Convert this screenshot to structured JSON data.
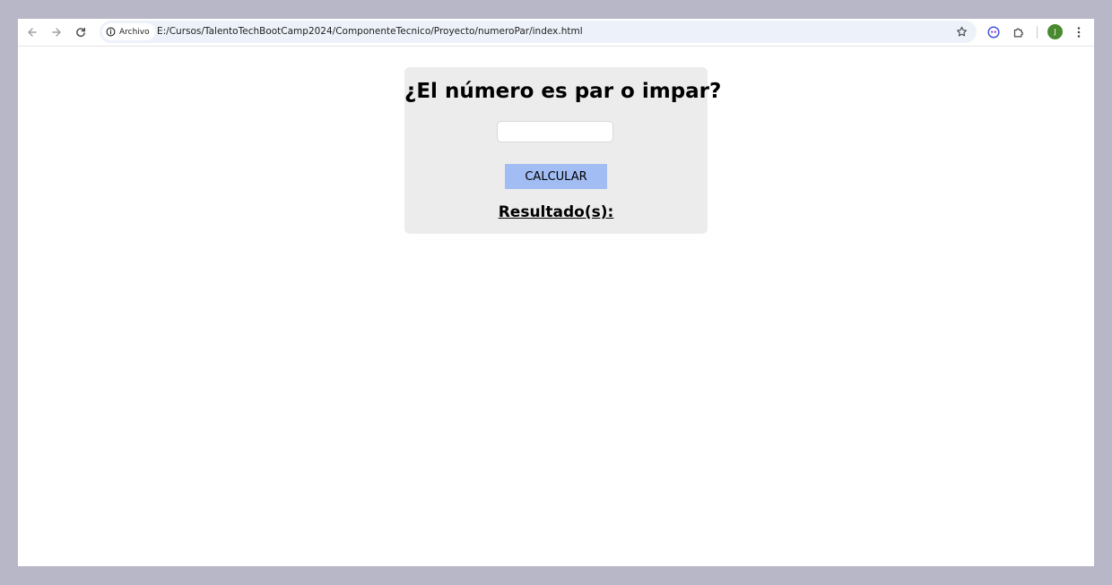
{
  "browser": {
    "site_info_label": "Archivo",
    "url": "E:/Cursos/TalentoTechBootCamp2024/ComponenteTecnico/Proyecto/numeroPar/index.html",
    "profile_initial": "J",
    "icons": {
      "back": "arrow-left-icon",
      "forward": "arrow-right-icon",
      "reload": "reload-icon",
      "info": "info-icon",
      "bookmark": "star-icon",
      "extension_1": "extension-face-icon",
      "extensions": "puzzle-icon",
      "menu": "kebab-menu-icon"
    }
  },
  "page": {
    "title": "¿El número es par o impar?",
    "input_value": "",
    "button_label": "CALCULAR",
    "result_label": "Resultado(s):"
  },
  "colors": {
    "card_background": "#ececec",
    "button_background": "#a2bdf4",
    "avatar": "#4a8a2f",
    "omnibox": "#edf2fa"
  }
}
